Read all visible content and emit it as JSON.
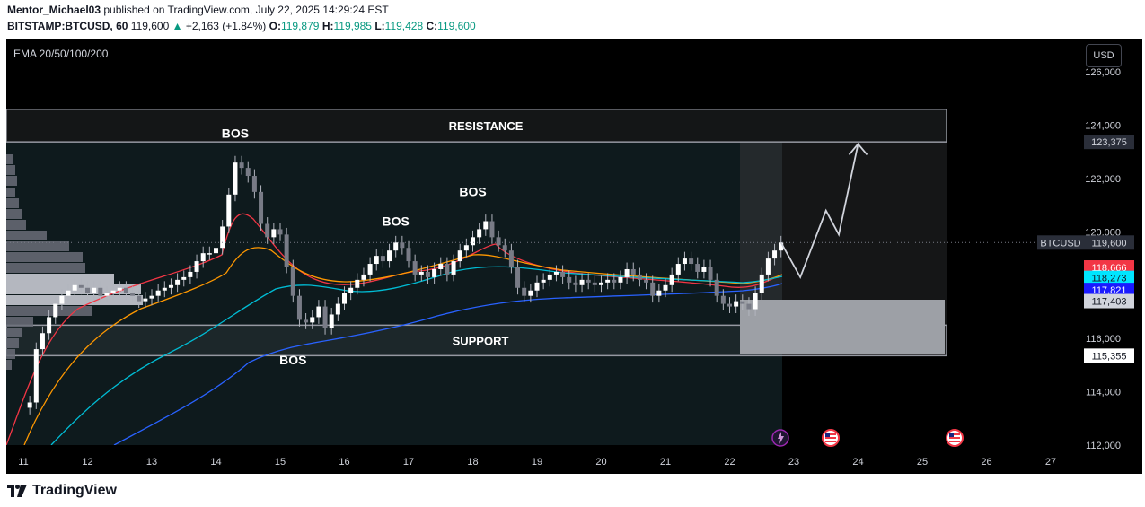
{
  "header": {
    "author": "Mentor_Michael03",
    "published_text": " published on TradingView.com, July 22, 2025 14:29:24 EST",
    "symbol": "BITSTAMP:BTCUSD, 60",
    "last": "119,600",
    "change_arrow": "▲",
    "change": "+2,163 (+1.84%)",
    "o_label": "O:",
    "o": "119,879",
    "h_label": "H:",
    "h": "119,985",
    "l_label": "L:",
    "l": "119,428",
    "c_label": "C:",
    "c": "119,600"
  },
  "indicator_label": "EMA 20/50/100/200",
  "currency_button": "USD",
  "footer": {
    "brand": "TradingView",
    "logo_icon": "tradingview-logo-icon"
  },
  "annotations": {
    "resistance": "RESISTANCE",
    "support": "SUPPORT",
    "bos_labels": [
      "BOS",
      "BOS",
      "BOS",
      "BOS"
    ]
  },
  "price_axis": {
    "ticks": [
      "126,000",
      "124,000",
      "122,000",
      "120,000",
      "116,000",
      "114,000",
      "112,000"
    ],
    "tags": [
      {
        "text": "123,375",
        "color": "#2a2e39",
        "text_color": "#d1d4dc",
        "value": 123375
      },
      {
        "text": "BTCUSD",
        "color": "#2a2e39",
        "text_color": "#d1d4dc",
        "value": 119600,
        "side": "left"
      },
      {
        "text": "119,600",
        "color": "#2a2e39",
        "text_color": "#d1d4dc",
        "value": 119600
      },
      {
        "text": "118,666",
        "color": "#f23645",
        "text_color": "#ffffff",
        "value": 118666
      },
      {
        "text": "118,273",
        "color": "#00e5ff",
        "text_color": "#131722",
        "value": 118273
      },
      {
        "text": "117,821",
        "color": "#1a1aff",
        "text_color": "#ffffff",
        "value": 117821
      },
      {
        "text": "117,403",
        "color": "#d1d4dc",
        "text_color": "#131722",
        "value": 117403
      },
      {
        "text": "115,355",
        "color": "#ffffff",
        "text_color": "#131722",
        "value": 115355
      }
    ]
  },
  "time_axis": {
    "labels": [
      "11",
      "12",
      "13",
      "14",
      "15",
      "16",
      "17",
      "18",
      "19",
      "20",
      "21",
      "22",
      "23",
      "24",
      "25",
      "26",
      "27"
    ]
  },
  "event_icons": [
    "lightning-event-icon",
    "us-flag-event-icon",
    "us-flag-event-icon"
  ],
  "chart_data": {
    "type": "candlestick",
    "symbol": "BITSTAMP:BTCUSD",
    "interval": "60",
    "ylim": [
      111500,
      126500
    ],
    "x_range_days": [
      11,
      27
    ],
    "resistance_zone": [
      123375,
      124600
    ],
    "support_zone": [
      115355,
      116500
    ],
    "bos_points": [
      {
        "day": 14.3,
        "price": 123200
      },
      {
        "day": 15.2,
        "price": 115700
      },
      {
        "day": 16.8,
        "price": 119900
      },
      {
        "day": 18.0,
        "price": 121000
      }
    ],
    "projection": [
      {
        "day": 22.8,
        "price": 119600
      },
      {
        "day": 23.1,
        "price": 118300
      },
      {
        "day": 23.5,
        "price": 120800
      },
      {
        "day": 23.7,
        "price": 119900
      },
      {
        "day": 24.0,
        "price": 123300
      }
    ],
    "close_path": [
      [
        11.0,
        113400
      ],
      [
        11.1,
        113600
      ],
      [
        11.2,
        115600
      ],
      [
        11.3,
        116200
      ],
      [
        11.4,
        116800
      ],
      [
        11.5,
        117300
      ],
      [
        11.6,
        117600
      ],
      [
        11.7,
        117800
      ],
      [
        11.8,
        118000
      ],
      [
        11.9,
        117900
      ],
      [
        12.0,
        117700
      ],
      [
        12.1,
        117900
      ],
      [
        12.2,
        117600
      ],
      [
        12.3,
        117700
      ],
      [
        12.4,
        117800
      ],
      [
        12.5,
        117900
      ],
      [
        12.6,
        117700
      ],
      [
        12.7,
        117600
      ],
      [
        12.8,
        117400
      ],
      [
        12.9,
        117500
      ],
      [
        13.0,
        117600
      ],
      [
        13.1,
        117800
      ],
      [
        13.2,
        117900
      ],
      [
        13.3,
        118000
      ],
      [
        13.4,
        118200
      ],
      [
        13.5,
        118300
      ],
      [
        13.6,
        118500
      ],
      [
        13.7,
        118900
      ],
      [
        13.8,
        119200
      ],
      [
        13.9,
        119200
      ],
      [
        14.0,
        119400
      ],
      [
        14.1,
        120200
      ],
      [
        14.2,
        121400
      ],
      [
        14.3,
        122600
      ],
      [
        14.4,
        122400
      ],
      [
        14.5,
        122100
      ],
      [
        14.6,
        121500
      ],
      [
        14.7,
        120300
      ],
      [
        14.8,
        119800
      ],
      [
        14.9,
        120100
      ],
      [
        15.0,
        119900
      ],
      [
        15.1,
        118700
      ],
      [
        15.2,
        117600
      ],
      [
        15.3,
        116700
      ],
      [
        15.4,
        116600
      ],
      [
        15.5,
        116800
      ],
      [
        15.6,
        117200
      ],
      [
        15.7,
        116400
      ],
      [
        15.8,
        116900
      ],
      [
        15.9,
        117300
      ],
      [
        16.0,
        117700
      ],
      [
        16.1,
        117900
      ],
      [
        16.2,
        118200
      ],
      [
        16.3,
        118400
      ],
      [
        16.4,
        118800
      ],
      [
        16.5,
        119100
      ],
      [
        16.6,
        118900
      ],
      [
        16.7,
        119300
      ],
      [
        16.8,
        119600
      ],
      [
        16.9,
        119400
      ],
      [
        17.0,
        118900
      ],
      [
        17.1,
        118400
      ],
      [
        17.2,
        118500
      ],
      [
        17.3,
        118300
      ],
      [
        17.4,
        118600
      ],
      [
        17.5,
        118800
      ],
      [
        17.6,
        118400
      ],
      [
        17.7,
        118900
      ],
      [
        17.8,
        119300
      ],
      [
        17.9,
        119500
      ],
      [
        18.0,
        119800
      ],
      [
        18.1,
        120100
      ],
      [
        18.2,
        120400
      ],
      [
        18.3,
        119800
      ],
      [
        18.4,
        119500
      ],
      [
        18.5,
        119300
      ],
      [
        18.6,
        118700
      ],
      [
        18.7,
        117900
      ],
      [
        18.8,
        117600
      ],
      [
        18.9,
        117800
      ],
      [
        19.0,
        118100
      ],
      [
        19.1,
        118200
      ],
      [
        19.2,
        118400
      ],
      [
        19.3,
        118500
      ],
      [
        19.4,
        118300
      ],
      [
        19.5,
        118100
      ],
      [
        19.6,
        118000
      ],
      [
        19.7,
        118200
      ],
      [
        19.8,
        118100
      ],
      [
        19.9,
        118000
      ],
      [
        20.0,
        118100
      ],
      [
        20.1,
        118200
      ],
      [
        20.2,
        118100
      ],
      [
        20.3,
        118300
      ],
      [
        20.4,
        118600
      ],
      [
        20.5,
        118400
      ],
      [
        20.6,
        118200
      ],
      [
        20.7,
        118100
      ],
      [
        20.8,
        117600
      ],
      [
        20.9,
        117800
      ],
      [
        21.0,
        118000
      ],
      [
        21.1,
        118400
      ],
      [
        21.2,
        118800
      ],
      [
        21.3,
        119000
      ],
      [
        21.4,
        118800
      ],
      [
        21.5,
        118500
      ],
      [
        21.6,
        118700
      ],
      [
        21.7,
        118200
      ],
      [
        21.8,
        117600
      ],
      [
        21.9,
        117300
      ],
      [
        22.0,
        117200
      ],
      [
        22.1,
        117400
      ],
      [
        22.2,
        117300
      ],
      [
        22.3,
        117100
      ],
      [
        22.4,
        117700
      ],
      [
        22.5,
        118400
      ],
      [
        22.6,
        119000
      ],
      [
        22.7,
        119300
      ],
      [
        22.8,
        119600
      ]
    ],
    "series": [
      {
        "name": "EMA 20",
        "color": "#f23645"
      },
      {
        "name": "EMA 50",
        "color": "#ff9800"
      },
      {
        "name": "EMA 100",
        "color": "#00bcd4"
      },
      {
        "name": "EMA 200",
        "color": "#2962ff"
      }
    ],
    "ema_last": {
      "EMA 20": 118666,
      "EMA 50": 118273,
      "EMA 100": 117821,
      "EMA 200": 117821
    }
  }
}
